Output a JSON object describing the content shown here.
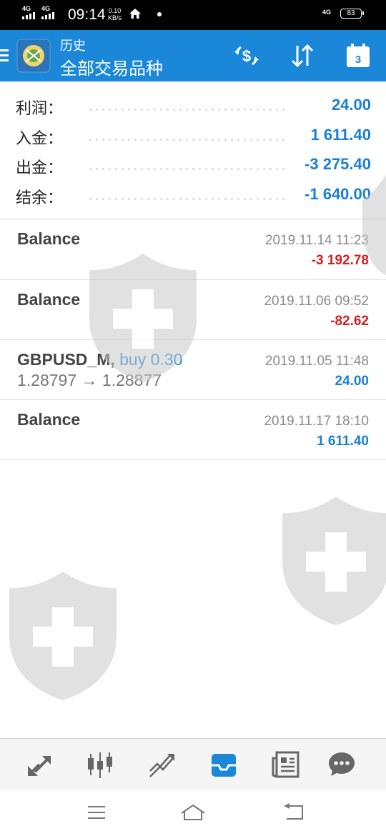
{
  "status_bar": {
    "network1": "4G",
    "network2": "4G",
    "time": "09:14",
    "speed_value": "0.10",
    "speed_unit": "KB/s",
    "network_right": "4G",
    "battery": "83"
  },
  "header": {
    "subtitle": "历史",
    "title": "全部交易品种",
    "calendar_day": "3",
    "icons": [
      "menu-icon",
      "app-logo-icon",
      "currency-exchange-icon",
      "sort-icon",
      "calendar-icon"
    ]
  },
  "summary": [
    {
      "label": "利润：",
      "value": "24.00"
    },
    {
      "label": "入金：",
      "value": "1 611.40"
    },
    {
      "label": "出金：",
      "value": "-3 275.40"
    },
    {
      "label": "结余：",
      "value": "-1 640.00"
    }
  ],
  "deals": [
    {
      "title": "Balance",
      "buy": "",
      "prices": "",
      "time": "2019.11.14 11:23",
      "amount": "-3 192.78",
      "sign": "neg"
    },
    {
      "title": "Balance",
      "buy": "",
      "prices": "",
      "time": "2019.11.06 09:52",
      "amount": "-82.62",
      "sign": "neg"
    },
    {
      "title": "GBPUSD_M,",
      "buy": "buy 0.30",
      "prices": "1.28797 → 1.28877",
      "time": "2019.11.05 11:48",
      "amount": "24.00",
      "sign": "pos"
    },
    {
      "title": "Balance",
      "buy": "",
      "prices": "",
      "time": "2019.11.17 18:10",
      "amount": "1 611.40",
      "sign": "pos"
    }
  ],
  "bottom_nav": [
    "quotes-icon",
    "chart-icon",
    "trade-icon",
    "history-icon",
    "news-icon",
    "chat-icon"
  ],
  "system_nav": [
    "recent-apps-icon",
    "home-icon",
    "back-icon"
  ],
  "colors": {
    "header_bg": "#1a87d9",
    "positive": "#1a7fd4",
    "negative": "#cf2020",
    "active_nav": "#1a87d9"
  }
}
